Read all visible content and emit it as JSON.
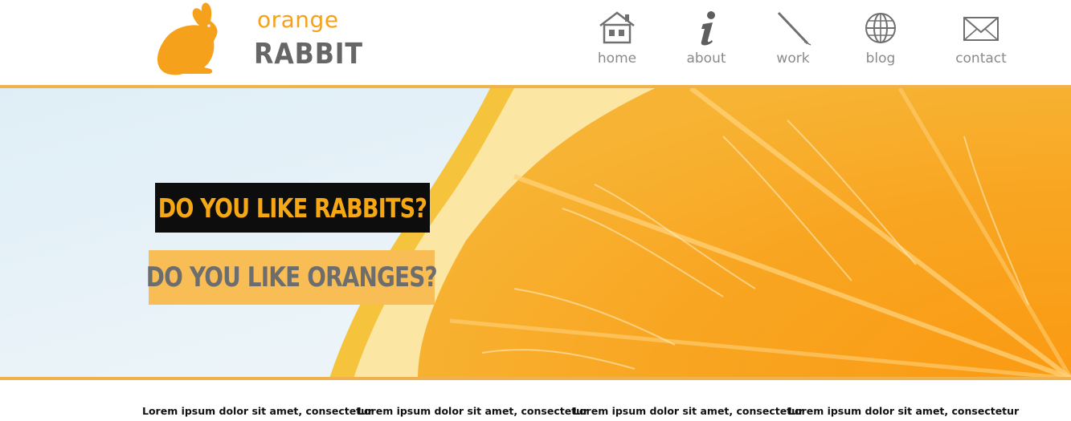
{
  "brand": {
    "word_top": "orange",
    "word_bottom": "RABBIT"
  },
  "nav": [
    {
      "label": "home",
      "icon": "home-icon"
    },
    {
      "label": "about",
      "icon": "info-icon"
    },
    {
      "label": "work",
      "icon": "pen-icon"
    },
    {
      "label": "blog",
      "icon": "globe-icon"
    },
    {
      "label": "contact",
      "icon": "envelope-icon"
    }
  ],
  "hero": {
    "headline_1": "DO YOU LIKE RABBITS?",
    "headline_2": "DO YOU LIKE ORANGES?"
  },
  "teasers": [
    "Lorem ipsum dolor sit amet, consectetur",
    "Lorem ipsum dolor sit amet, consectetur",
    "Lorem ipsum dolor sit amet, consectetur",
    "Lorem ipsum dolor sit amet, consectetur"
  ],
  "colors": {
    "accent": "#f5a11b",
    "rule": "#f0b24c",
    "nav_text": "#8a8a8a",
    "headline_box_dark": "#0d0d0d",
    "headline_box_light": "#f8bd55"
  }
}
